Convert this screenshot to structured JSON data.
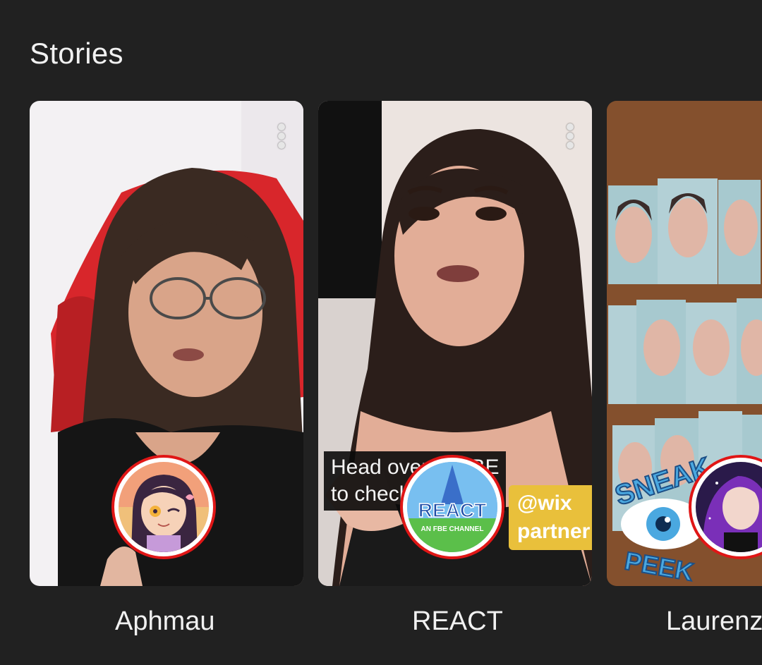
{
  "section": {
    "title": "Stories"
  },
  "stories": [
    {
      "name": "Aphmau"
    },
    {
      "name": "REACT",
      "caption": [
        "Head over to FBE",
        "to check"
      ],
      "sticker": [
        "@wix",
        "partner"
      ],
      "avatar_text": [
        "REACT",
        "AN FBE CHANNEL"
      ]
    },
    {
      "name": "Laurenzside",
      "sticker_text": [
        "SNEAK",
        "PEEK"
      ]
    }
  ],
  "colors": {
    "background": "#212121",
    "ring": "#e01616",
    "text": "#f1f1f1"
  },
  "icons": {
    "menu": "more-vert-icon"
  }
}
